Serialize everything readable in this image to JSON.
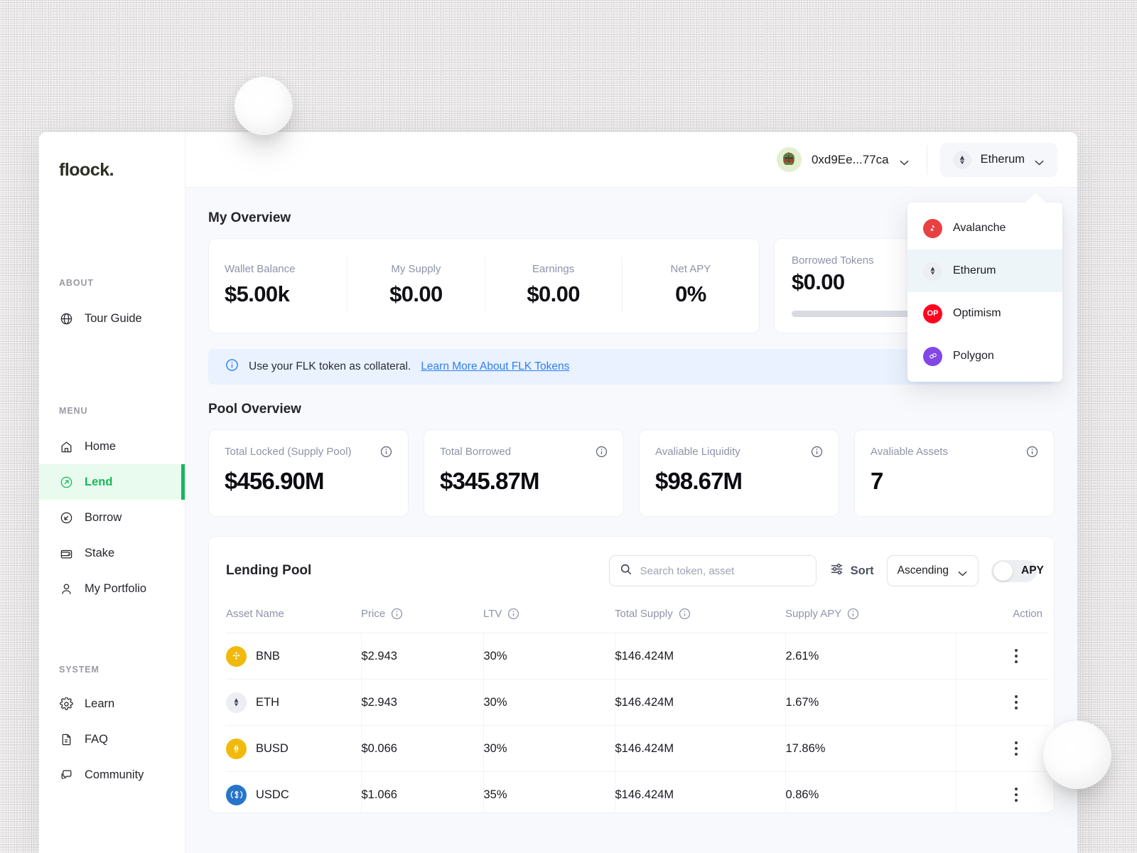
{
  "app": {
    "logo": "floock."
  },
  "sidebar": {
    "sections": [
      {
        "label": "ABOUT",
        "items": [
          {
            "label": "Tour Guide",
            "icon": "globe-icon"
          }
        ]
      },
      {
        "label": "MENU",
        "items": [
          {
            "label": "Home",
            "icon": "home-icon"
          },
          {
            "label": "Lend",
            "icon": "arrow-up-right-circle-icon",
            "active": true
          },
          {
            "label": "Borrow",
            "icon": "arrow-down-left-circle-icon"
          },
          {
            "label": "Stake",
            "icon": "wallet-icon"
          },
          {
            "label": "My Portfolio",
            "icon": "user-icon"
          }
        ]
      },
      {
        "label": "SYSTEM",
        "items": [
          {
            "label": "Learn",
            "icon": "gear-icon"
          },
          {
            "label": "FAQ",
            "icon": "document-icon"
          },
          {
            "label": "Community",
            "icon": "chat-icon"
          }
        ]
      }
    ]
  },
  "topbar": {
    "wallet_address": "0xd9Ee...77ca",
    "network": "Etherum",
    "avatar": "helmet-avatar-icon"
  },
  "network_menu": {
    "options": [
      {
        "label": "Avalanche",
        "color": "#e84142",
        "icon": "avalanche-icon",
        "selected": false
      },
      {
        "label": "Etherum",
        "color": "#eceef3",
        "icon": "ethereum-icon",
        "selected": true
      },
      {
        "label": "Optimism",
        "color": "#ff0420",
        "icon": "optimism-icon",
        "selected": false
      },
      {
        "label": "Polygon",
        "color": "#8247e5",
        "icon": "polygon-icon",
        "selected": false
      }
    ]
  },
  "my_overview": {
    "title": "My Overview",
    "stats": [
      {
        "label": "Wallet Balance",
        "value": "$5.00k"
      },
      {
        "label": "My Supply",
        "value": "$0.00"
      },
      {
        "label": "Earnings",
        "value": "$0.00"
      },
      {
        "label": "Net APY",
        "value": "0%"
      }
    ],
    "borrowed": {
      "label": "Borrowed Tokens",
      "value": "$0.00",
      "progress_percent": 0
    }
  },
  "banner": {
    "text": "Use your FLK token as collateral.",
    "link": "Learn More About FLK Tokens"
  },
  "pool_overview": {
    "title": "Pool Overview",
    "cards": [
      {
        "label": "Total Locked (Supply Pool)",
        "value": "$456.90M"
      },
      {
        "label": "Total Borrowed",
        "value": "$345.87M"
      },
      {
        "label": "Avaliable Liquidity",
        "value": "$98.67M"
      },
      {
        "label": "Avaliable Assets",
        "value": "7"
      }
    ]
  },
  "lending_pool": {
    "title": "Lending Pool",
    "search_placeholder": "Search token, asset",
    "search_value": "",
    "sort_label": "Sort",
    "sort_value": "Ascending",
    "apy_toggle_label": "APY",
    "apy_toggle_on": false,
    "columns": [
      {
        "label": "Asset Name",
        "info": false
      },
      {
        "label": "Price",
        "info": true
      },
      {
        "label": "LTV",
        "info": true
      },
      {
        "label": "Total Supply",
        "info": true
      },
      {
        "label": "Supply APY",
        "info": true
      },
      {
        "label": "Action",
        "info": false
      }
    ],
    "rows": [
      {
        "asset": "BNB",
        "color": "#f0b90b",
        "price": "$2.943",
        "ltv": "30%",
        "total_supply": "$146.424M",
        "supply_apy": "2.61%"
      },
      {
        "asset": "ETH",
        "color": "#eceef3",
        "price": "$2.943",
        "ltv": "30%",
        "total_supply": "$146.424M",
        "supply_apy": "1.67%"
      },
      {
        "asset": "BUSD",
        "color": "#f0b90b",
        "price": "$0.066",
        "ltv": "30%",
        "total_supply": "$146.424M",
        "supply_apy": "17.86%"
      },
      {
        "asset": "USDC",
        "color": "#2775ca",
        "price": "$1.066",
        "ltv": "35%",
        "total_supply": "$146.424M",
        "supply_apy": "0.86%"
      }
    ]
  },
  "theme": {
    "accent_green": "#14b85c",
    "accent_blue": "#2f7df6",
    "page_bg": "#f8f9fc"
  }
}
